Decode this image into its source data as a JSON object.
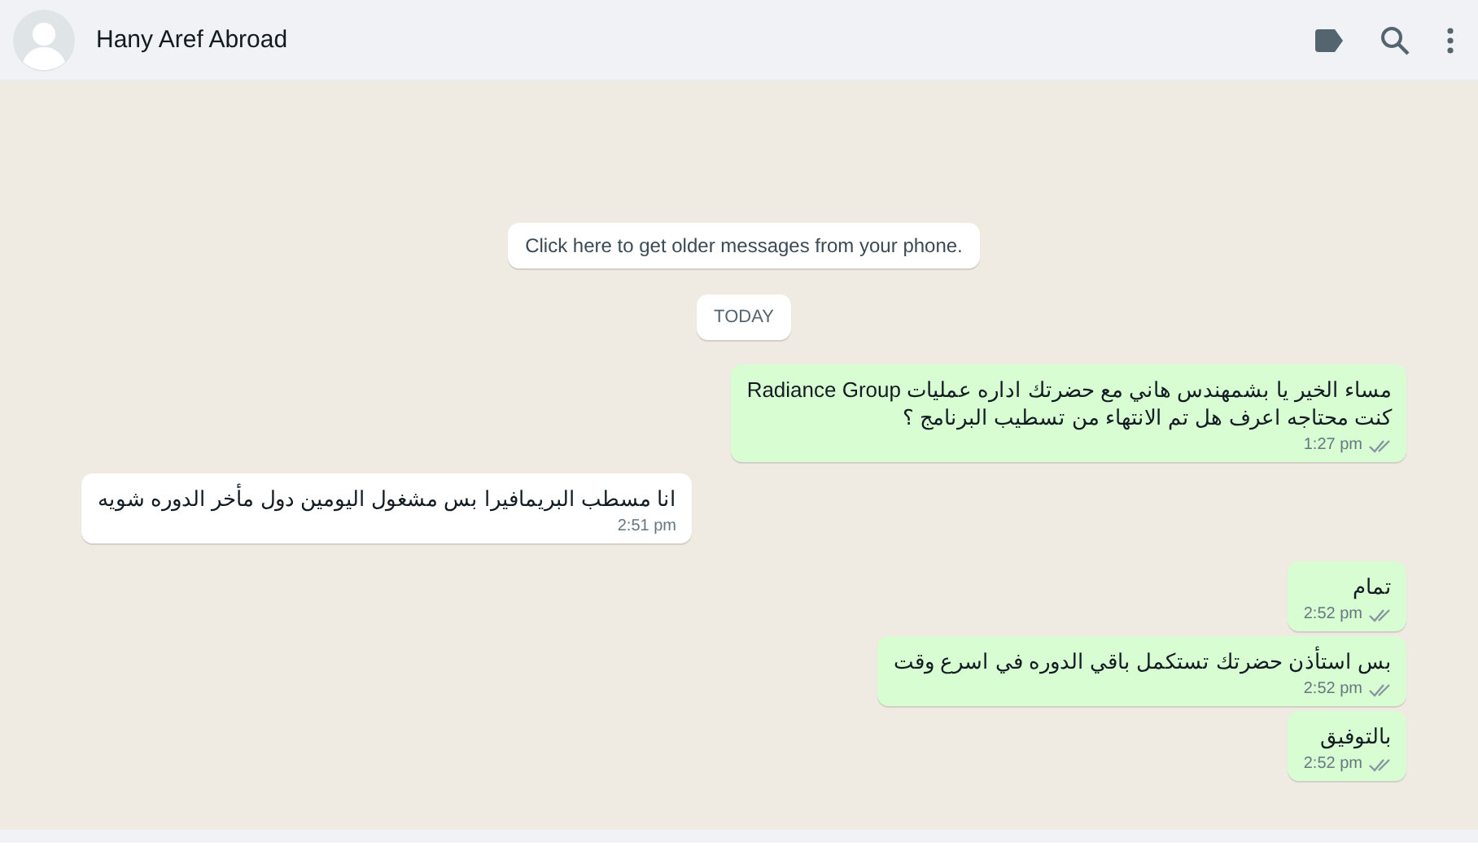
{
  "header": {
    "contact_name": "Hany Aref Abroad"
  },
  "older_messages_notice": "Click here to get older messages from your phone.",
  "date_divider": "TODAY",
  "messages": [
    {
      "kind": "outgoing",
      "lines": [
        "مساء الخير يا بشمهندس هاني مع حضرتك اداره عمليات Radiance Group",
        "كنت محتاجه اعرف هل تم الانتهاء من تسطيب البرنامج ؟"
      ],
      "time": "1:27 pm"
    },
    {
      "kind": "incoming",
      "lines": [
        "انا مسطب البريمافيرا بس مشغول اليومين دول مأخر الدوره شويه"
      ],
      "time": "2:51 pm"
    },
    {
      "kind": "outgoing",
      "lines": [
        "تمام"
      ],
      "time": "2:52 pm"
    },
    {
      "kind": "outgoing",
      "lines": [
        "بس استأذن حضرتك تستكمل باقي الدوره في اسرع وقت"
      ],
      "time": "2:52 pm"
    },
    {
      "kind": "outgoing",
      "lines": [
        "بالتوفيق"
      ],
      "time": "2:52 pm"
    }
  ]
}
